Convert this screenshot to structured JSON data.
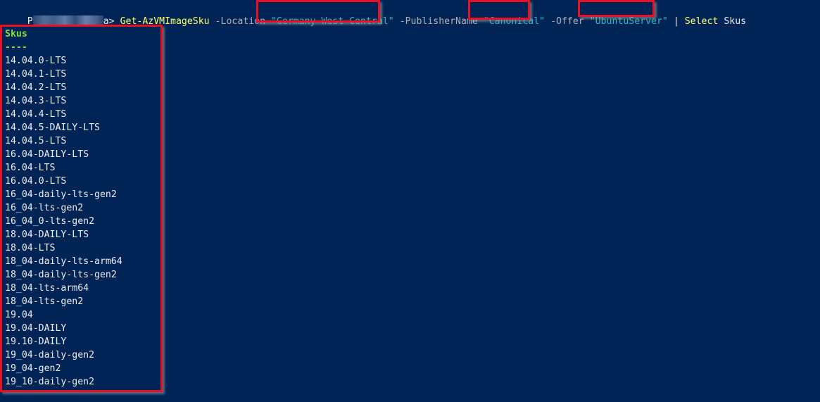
{
  "terminal": {
    "background": "#012456",
    "prompt": {
      "prefix_visible_start": "P",
      "prefix_redacted": true,
      "prefix_visible_end": "a>"
    },
    "command": {
      "cmdlet": "Get-AzVMImageSku",
      "params": [
        {
          "name": "-Location",
          "value": "Germany West Central"
        },
        {
          "name": "-PublisherName",
          "value": "Canonical"
        },
        {
          "name": "-Offer",
          "value": "UbuntuServer"
        }
      ],
      "pipe": "|",
      "pipe_cmd": "Select",
      "pipe_arg": "Skus"
    },
    "output": {
      "header": "Skus",
      "underline": "----",
      "rows": [
        "14.04.0-LTS",
        "14.04.1-LTS",
        "14.04.2-LTS",
        "14.04.3-LTS",
        "14.04.4-LTS",
        "14.04.5-DAILY-LTS",
        "14.04.5-LTS",
        "16.04-DAILY-LTS",
        "16.04-LTS",
        "16.04.0-LTS",
        "16_04-daily-lts-gen2",
        "16_04-lts-gen2",
        "16_04_0-lts-gen2",
        "18.04-DAILY-LTS",
        "18.04-LTS",
        "18_04-daily-lts-arm64",
        "18_04-daily-lts-gen2",
        "18_04-lts-arm64",
        "18_04-lts-gen2",
        "19.04",
        "19.04-DAILY",
        "19.10-DAILY",
        "19_04-daily-gen2",
        "19_04-gen2",
        "19_10-daily-gen2"
      ]
    },
    "colors": {
      "cmdlet": "#ffff66",
      "param": "#b0b0b0",
      "string": "#2fb9c5",
      "header": "#80e040",
      "text": "#eeedf0",
      "annotation_box": "#e81123"
    }
  }
}
